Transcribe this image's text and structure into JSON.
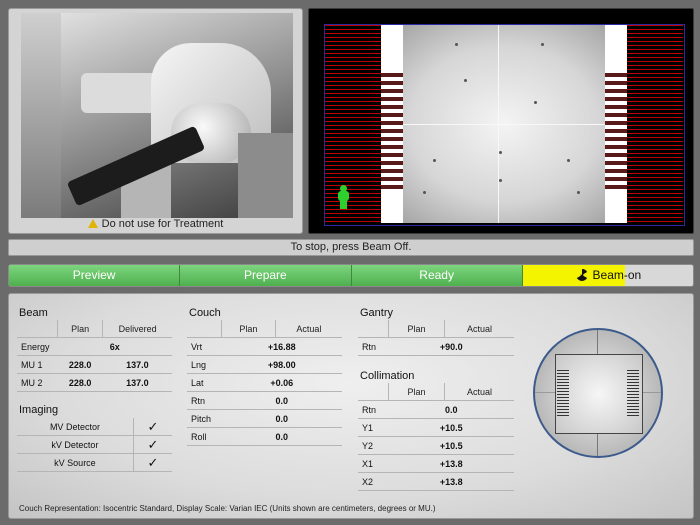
{
  "camera": {
    "warning_text": "Do not use for Treatment",
    "warning_icon": "warning-triangle-icon"
  },
  "status_bar": {
    "text": "To stop, press Beam Off."
  },
  "workflow": {
    "steps": [
      "Preview",
      "Prepare",
      "Ready",
      "Beam-on"
    ],
    "active_step": "Beam-on",
    "beam_on_icon": "radiation-icon",
    "colors": {
      "done": "#5cbf5c",
      "active": "#f4f400",
      "idle": "#d8d8d8"
    }
  },
  "beam": {
    "title": "Beam",
    "col_plan": "Plan",
    "col_delivered": "Delivered",
    "rows": [
      {
        "label": "Energy",
        "plan": "6x",
        "delivered": ""
      },
      {
        "label": "MU 1",
        "plan": "228.0",
        "delivered": "137.0"
      },
      {
        "label": "MU 2",
        "plan": "228.0",
        "delivered": "137.0"
      }
    ]
  },
  "imaging": {
    "title": "Imaging",
    "rows": [
      {
        "label": "MV Detector",
        "checked": "✓"
      },
      {
        "label": "kV Detector",
        "checked": "✓"
      },
      {
        "label": "kV Source",
        "checked": "✓"
      }
    ]
  },
  "couch": {
    "title": "Couch",
    "col_plan": "Plan",
    "col_actual": "Actual",
    "rows": [
      {
        "label": "Vrt",
        "value": "+16.88"
      },
      {
        "label": "Lng",
        "value": "+98.00"
      },
      {
        "label": "Lat",
        "value": "+0.06"
      },
      {
        "label": "Rtn",
        "value": "0.0"
      },
      {
        "label": "Pitch",
        "value": "0.0"
      },
      {
        "label": "Roll",
        "value": "0.0"
      }
    ]
  },
  "gantry": {
    "title": "Gantry",
    "col_plan": "Plan",
    "col_actual": "Actual",
    "rows": [
      {
        "label": "Rtn",
        "value": "+90.0"
      }
    ]
  },
  "collimation": {
    "title": "Collimation",
    "col_plan": "Plan",
    "col_actual": "Actual",
    "rows": [
      {
        "label": "Rtn",
        "value": "0.0"
      },
      {
        "label": "Y1",
        "value": "+10.5"
      },
      {
        "label": "Y2",
        "value": "+10.5"
      },
      {
        "label": "X1",
        "value": "+13.8"
      },
      {
        "label": "X2",
        "value": "+13.8"
      }
    ]
  },
  "footnote": "Couch Representation: Isocentric Standard, Display Scale: Varian IEC (Units shown are centimeters, degrees or MU.)"
}
